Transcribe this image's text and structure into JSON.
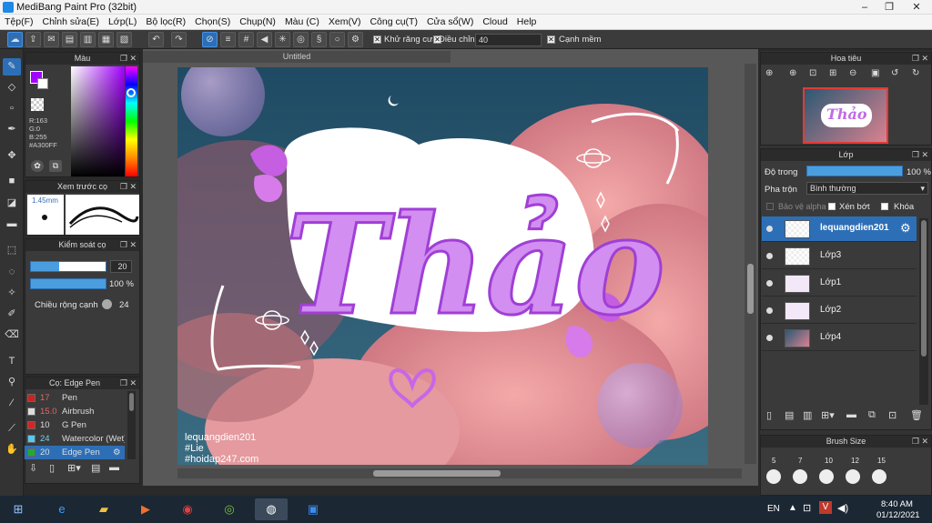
{
  "window": {
    "title": "MediBang Paint Pro (32bit)"
  },
  "menu": [
    "Tệp(F)",
    "Chỉnh sửa(E)",
    "Lớp(L)",
    "Bộ lọc(R)",
    "Chọn(S)",
    "Chụp(N)",
    "Màu (C)",
    "Xem(V)",
    "Công cụ(T)",
    "Cửa sổ(W)",
    "Cloud",
    "Help"
  ],
  "toolbar": {
    "antialias_label": "Khử răng cưa",
    "adjust_label": "Điều chỉnh",
    "adjust_value": "40",
    "sharp_edge_label": "Cạnh mềm"
  },
  "color_panel": {
    "title": "Màu",
    "r": "R:163",
    "g": "G:0",
    "b": "B:255",
    "hex": "#A300FF",
    "accent": "#A300FF"
  },
  "preview_panel": {
    "title": "Xem trước cọ",
    "size": "1.45mm"
  },
  "control_panel": {
    "title": "Kiểm soát cọ",
    "size_value": "20",
    "opacity_value": "100 %",
    "width_label": "Chiều rộng cạnh",
    "width_value": "24"
  },
  "brush_panel": {
    "title": "Cọ: Edge Pen",
    "items": [
      {
        "size": "17",
        "name": "Pen",
        "color": "#cc2222"
      },
      {
        "size": "15.0",
        "name": "Airbrush",
        "color": "#dddddd"
      },
      {
        "size": "10",
        "name": "G Pen",
        "color": "#dd2222"
      },
      {
        "size": "24",
        "name": "Watercolor (Wet)",
        "color": "#58c8f0"
      },
      {
        "size": "20",
        "name": "Edge Pen",
        "color": "#22aa33"
      }
    ]
  },
  "document": {
    "tab": "Untitled"
  },
  "artwork": {
    "main_text": "Thảo",
    "watermark": [
      "lequangdien201",
      "#Lie",
      "#hoidap247.com"
    ]
  },
  "navigator": {
    "title": "Hoa tiêu"
  },
  "layers_panel": {
    "title": "Lớp",
    "opacity_label": "Độ trong",
    "opacity_value": "100 %",
    "blend_label": "Pha trộn",
    "blend_value": "Bình thường",
    "protect_alpha": "Bảo vệ alpha",
    "clipping": "Xén bớt",
    "lock": "Khóa",
    "layers": [
      "lequangdien201",
      "Lớp3",
      "Lớp1",
      "Lớp2",
      "Lớp4"
    ]
  },
  "brush_size_panel": {
    "title": "Brush Size",
    "sizes": [
      "5",
      "7",
      "10",
      "12",
      "15"
    ]
  },
  "taskbar": {
    "lang": "EN",
    "time": "8:40 AM",
    "date": "01/12/2021"
  }
}
